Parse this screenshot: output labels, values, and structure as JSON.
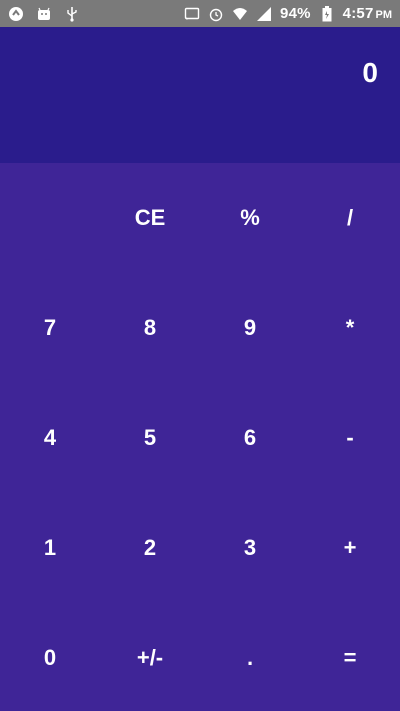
{
  "colors": {
    "status_bar_bg": "#7a7a7a",
    "display_bg": "#2a1c8c",
    "keypad_bg": "#3f2597",
    "text": "#ffffff"
  },
  "status_bar": {
    "left_icons": [
      "app-circle-icon",
      "android-icon",
      "usb-icon"
    ],
    "right_icons": [
      "cast-icon",
      "alarm-icon",
      "wifi-icon",
      "signal-icon",
      "battery-icon"
    ],
    "battery": "94%",
    "time": "4:57",
    "ampm": "PM"
  },
  "display": {
    "value": "0"
  },
  "keypad": {
    "rows": [
      [
        "",
        "CE",
        "%",
        "/"
      ],
      [
        "7",
        "8",
        "9",
        "*"
      ],
      [
        "4",
        "5",
        "6",
        "-"
      ],
      [
        "1",
        "2",
        "3",
        "+"
      ],
      [
        "0",
        "+/-",
        ".",
        "="
      ]
    ]
  }
}
